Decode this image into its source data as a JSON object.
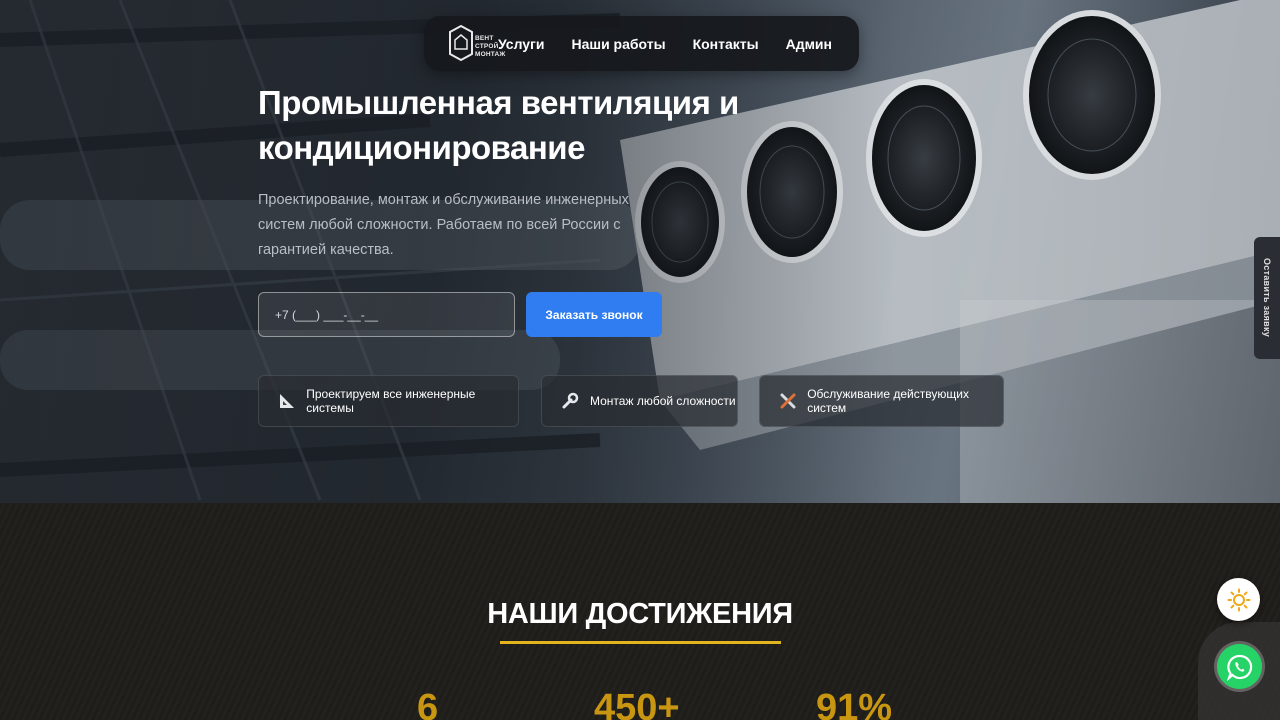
{
  "nav": {
    "logo_line1": "ВЕНТ СТРОЙ",
    "logo_line2": "МОНТАЖ",
    "items": [
      "Услуги",
      "Наши работы",
      "Контакты",
      "Админ"
    ]
  },
  "hero": {
    "title": "Промышленная вентиляция и кондиционирование",
    "subtitle": "Проектирование, монтаж и обслуживание инженерных систем любой сложности. Работаем по всей России с гарантией качества.",
    "phone_placeholder": "+7 (___) ___-__-__",
    "cta_label": "Заказать звонок",
    "features": [
      {
        "icon": "ruler-triangle-icon",
        "label": "Проектируем все инженерные системы"
      },
      {
        "icon": "wrench-icon",
        "label": "Монтаж любой сложности"
      },
      {
        "icon": "tools-icon",
        "label": "Обслуживание действующих систем"
      }
    ]
  },
  "side_tab": {
    "label": "Оставить заявку"
  },
  "achievements": {
    "title": "НАШИ ДОСТИЖЕНИЯ",
    "stats": [
      "6",
      "450+",
      "91%"
    ]
  },
  "colors": {
    "accent_blue": "#2f7df0",
    "accent_gold": "#e2b51e",
    "stat_gold": "#c99612",
    "whatsapp_green": "#25d366"
  }
}
